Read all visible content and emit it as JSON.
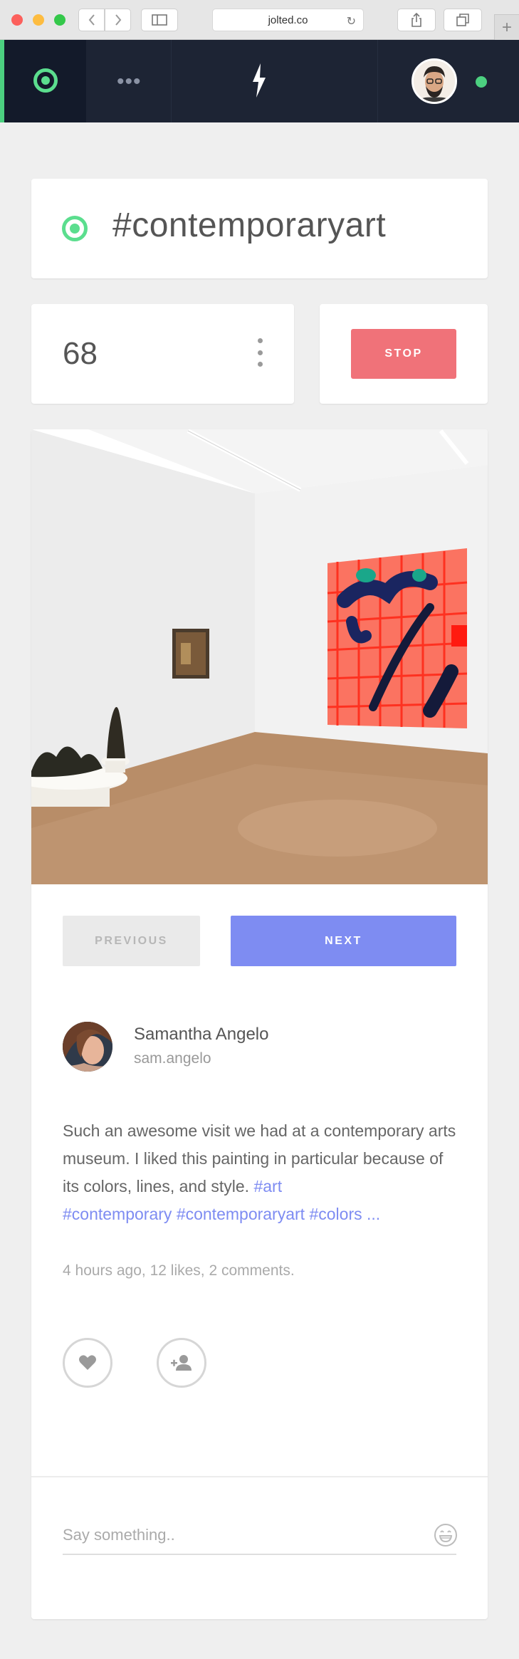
{
  "browser": {
    "url": "jolted.co"
  },
  "tag": {
    "text": "#contemporaryart"
  },
  "counter": {
    "value": "68",
    "stop_label": "STOP"
  },
  "post": {
    "prev_label": "PREVIOUS",
    "next_label": "NEXT",
    "author": {
      "name": "Samantha Angelo",
      "handle": "sam.angelo"
    },
    "body_text": "Such an awesome visit we had at a contemporary arts museum. I liked this painting in particular because of its colors, lines, and style.",
    "hashtags": [
      "#art",
      "#contemporary",
      "#contemporaryart",
      "#colors"
    ],
    "ellipsis": "...",
    "meta": "4 hours ago, 12 likes, 2 comments.",
    "comment_placeholder": "Say something.."
  },
  "colors": {
    "accent_green": "#5bde8e",
    "accent_blue": "#7e8cf2",
    "stop_red": "#f07279",
    "nav_bg": "#1d2434"
  },
  "icons": [
    "back-icon",
    "forward-icon",
    "sidebar-icon",
    "reload-icon",
    "share-icon",
    "tabs-icon",
    "plus-icon",
    "status-ring-icon",
    "more-dots-icon",
    "bolt-logo-icon",
    "heart-icon",
    "add-user-icon",
    "emoji-icon"
  ]
}
